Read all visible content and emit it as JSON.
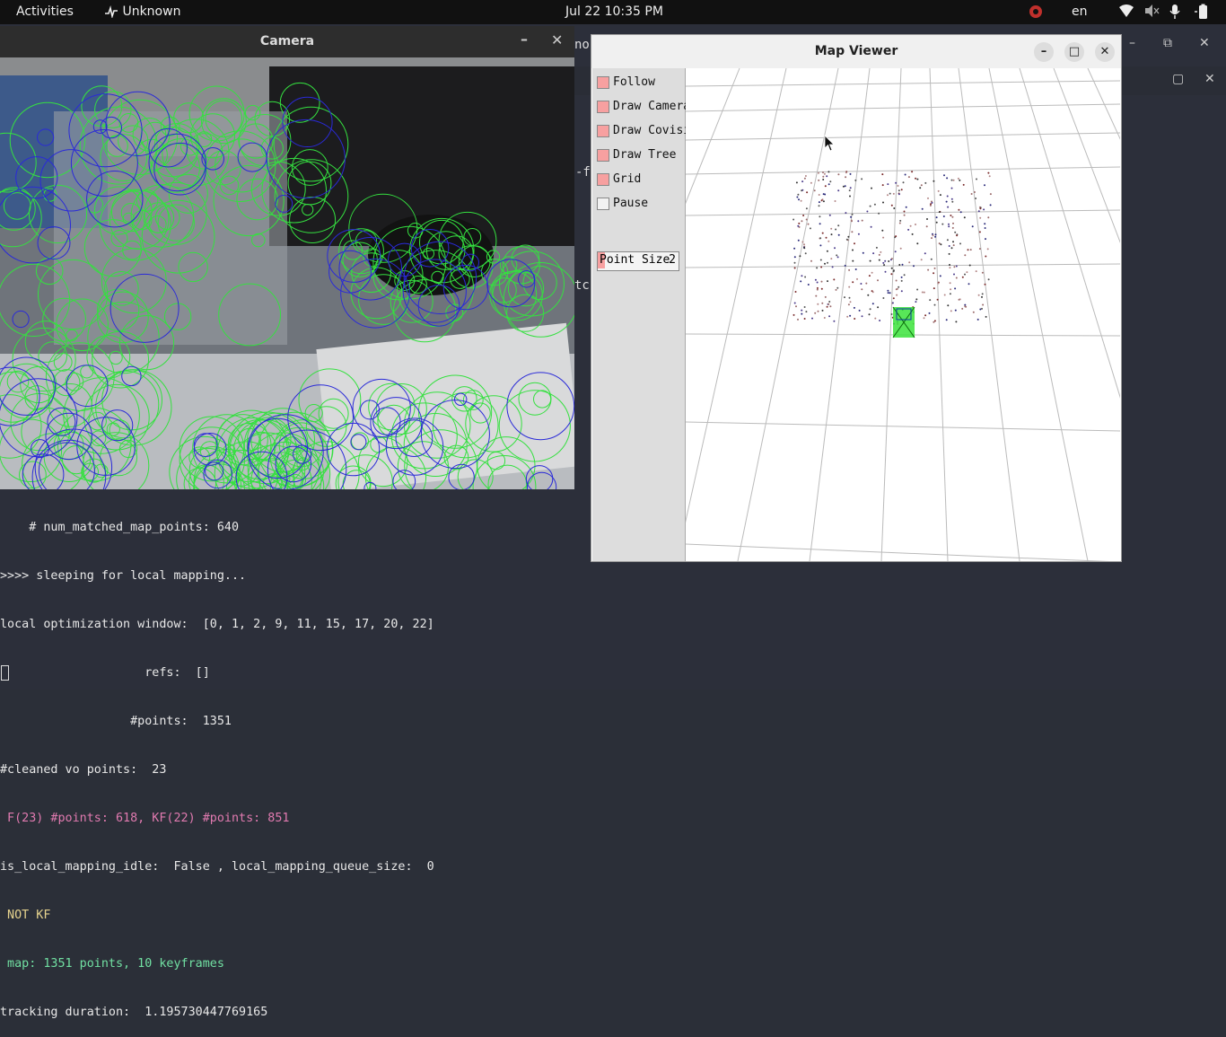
{
  "topbar": {
    "activities": "Activities",
    "app_name": "Unknown",
    "clock": "Jul 22  10:35 PM",
    "language": "en"
  },
  "camera_window": {
    "title": "Camera",
    "minimize": "–",
    "close": "✕"
  },
  "map_window": {
    "title": "Map Viewer",
    "minimize": "–",
    "maximize": "□",
    "close": "✕",
    "controls": [
      {
        "label": "Follow",
        "checked": true
      },
      {
        "label": "Draw Cameras",
        "checked": true
      },
      {
        "label": "Draw Covisibility",
        "checked": true
      },
      {
        "label": "Draw Tree",
        "checked": true
      },
      {
        "label": "Grid",
        "checked": true
      },
      {
        "label": "Pause",
        "checked": false
      }
    ],
    "point_size": {
      "label": "Point Size",
      "value": "2"
    }
  },
  "background_terminal": {
    "frag_top": "nor",
    "frag_mid": "-f",
    "frag_low": "tc"
  },
  "terminal": {
    "lines": [
      "    # num_matched_map_points: 640",
      ">>>> sleeping for local mapping...",
      "local optimization window:  [0, 1, 2, 9, 11, 15, 17, 20, 22]",
      "                    refs:  []",
      "                  #points:  1351",
      "#cleaned vo points:  23",
      " F(23) #points: 618, KF(22) #points: 851",
      "is_local_mapping_idle:  False , local_mapping_queue_size:  0",
      " NOT KF",
      " map: 1351 points, 10 keyframes",
      "tracking duration:  1.195730447769165"
    ]
  }
}
